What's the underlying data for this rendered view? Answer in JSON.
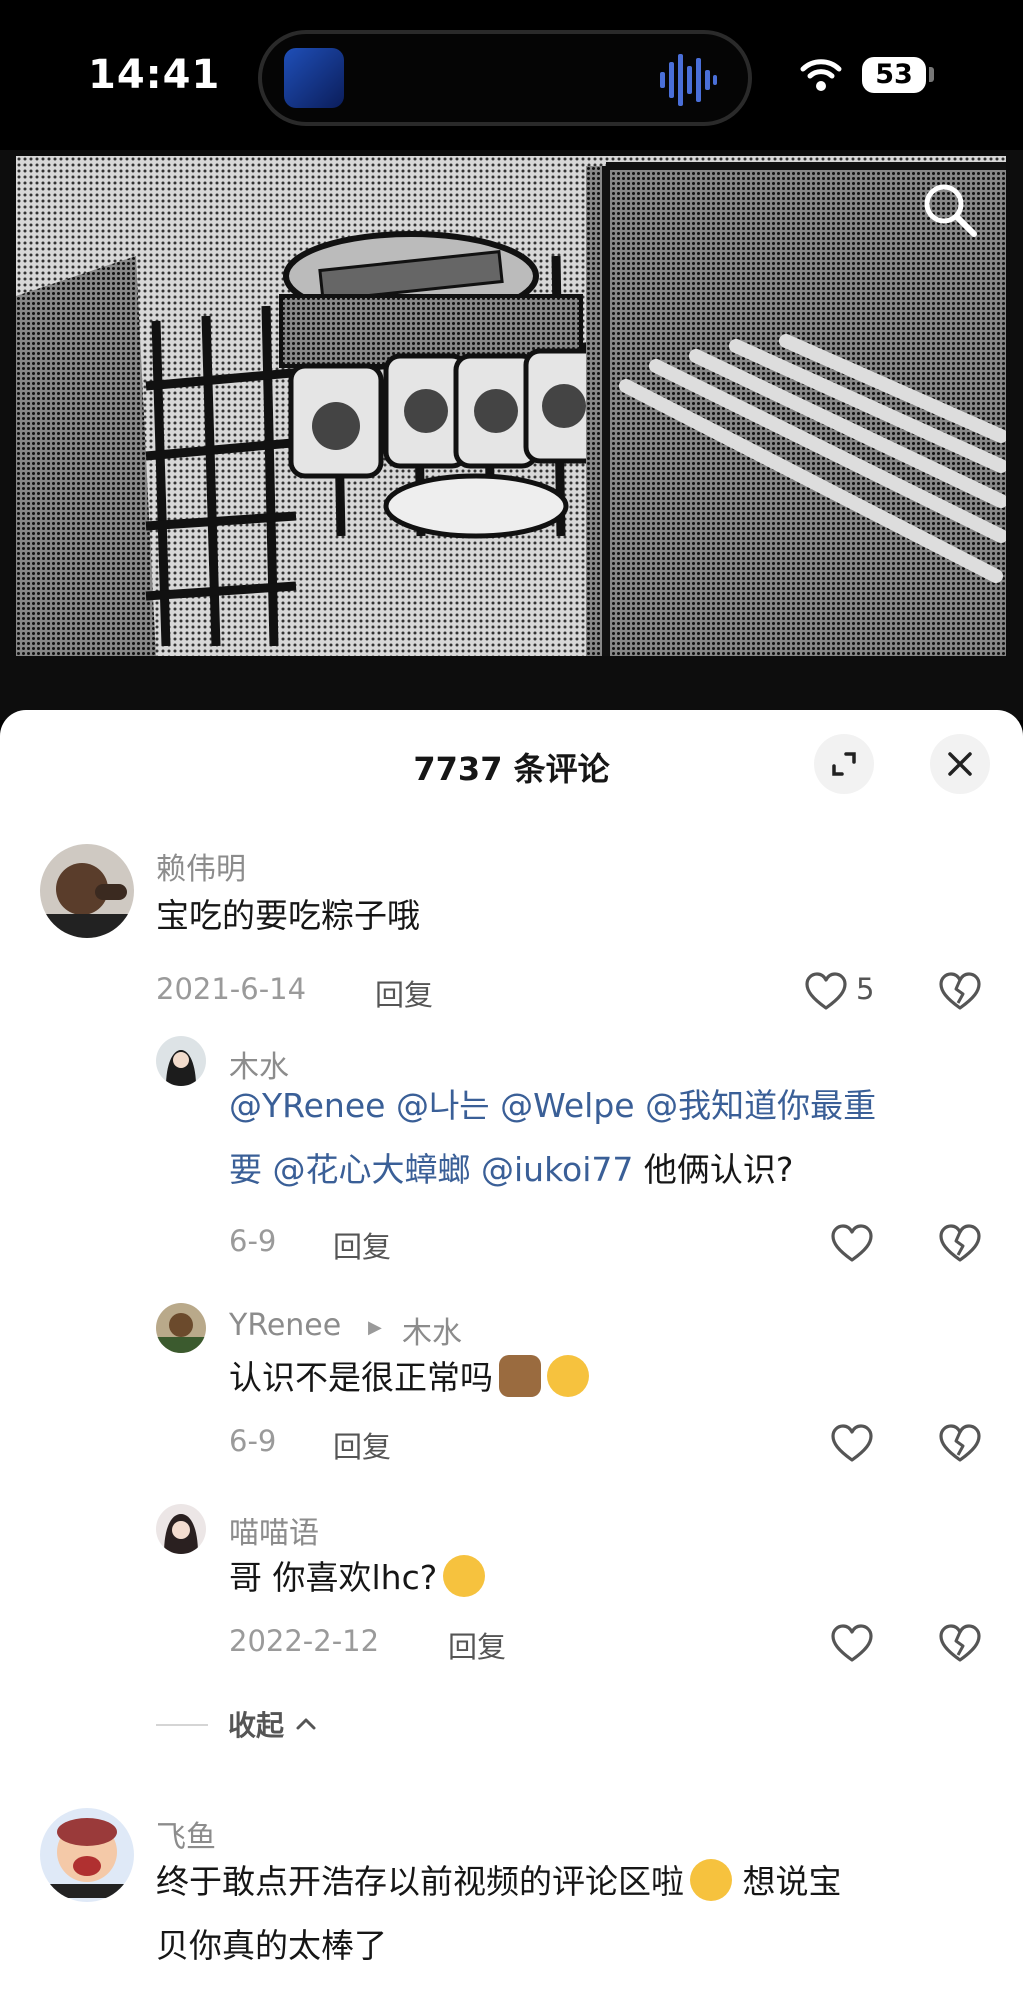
{
  "status_bar": {
    "time": "14:41",
    "battery": "53"
  },
  "sheet": {
    "title": "7737 条评论"
  },
  "comments": [
    {
      "user": "赖伟明",
      "text": "宝吃的要吃粽子哦",
      "date": "2021-6-14",
      "reply_label": "回复",
      "likes": "5",
      "replies": [
        {
          "user": "木水",
          "mentions": [
            "@YRenee",
            "@나는",
            "@Welpe",
            "@我知道你最重",
            "要",
            "@花心大蟑螂",
            "@iukoi77"
          ],
          "text_tail": "他俩认识?",
          "date": "6-9",
          "reply_label": "回复"
        },
        {
          "user": "YRenee",
          "reply_to": "木水",
          "text": "认识不是很正常吗",
          "date": "6-9",
          "reply_label": "回复"
        },
        {
          "user": "喵喵语",
          "text": "哥 你喜欢lhc?",
          "date": "2022-2-12",
          "reply_label": "回复"
        }
      ],
      "collapse_label": "收起"
    },
    {
      "user": "飞鱼",
      "text_part1": "终于敢点开浩存以前视频的评论区啦",
      "text_part2": "想说宝",
      "text_line2": "贝你真的太棒了"
    }
  ]
}
